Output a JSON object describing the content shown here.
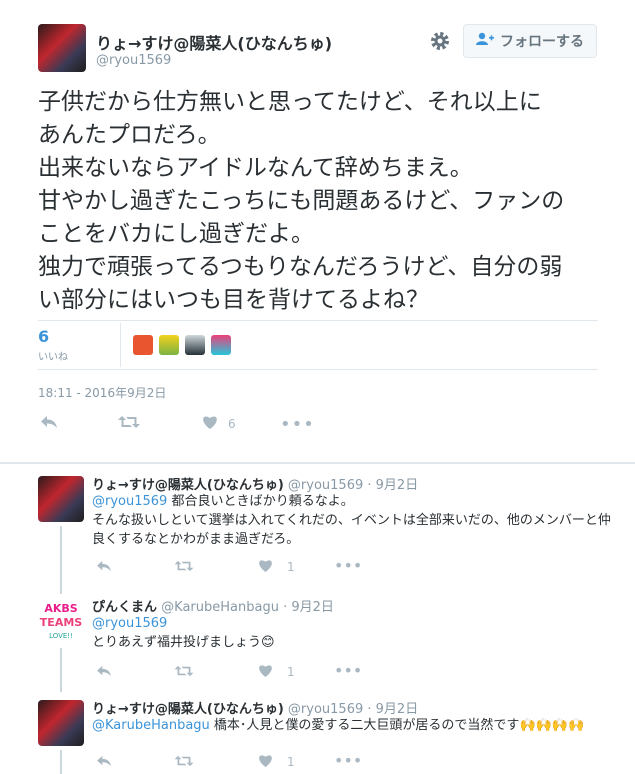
{
  "main_tweet": {
    "display_name": "りょ→すけ@陽菜人(ひなんちゅ)",
    "handle": "@ryou1569",
    "follow_label": "フォローする",
    "text": "子供だから仕方無いと思ってたけど、それ以上に\nあんたプロだろ。\n出来ないならアイドルなんて辞めちまえ。\n甘やかし過ぎたこっちにも問題あるけど、ファンの\nことをバカにし過ぎだよ。\n独力で頑張ってるつもりなんだろうけど、自分の弱\nい部分にはいつも目を背けてるよね？",
    "likes_count": "6",
    "likes_label": "いいね",
    "timestamp": "18:11 - 2016年9月2日",
    "action_like_count": "6"
  },
  "replies": [
    {
      "display_name": "りょ→すけ@陽菜人(ひなんちゅ)",
      "handle": "@ryou1569",
      "date": "· 9月2日",
      "mention": "@ryou1569",
      "text_inline": " 都合良いときばかり頼るなよ。",
      "text_rest": "そんな扱いしといて選挙は入れてくれだの、イベントは全部来いだの、他のメンバーと仲良くするなとかわがまま過ぎだろ。",
      "like_count": "1"
    },
    {
      "display_name": "ぴんくまん",
      "handle": "@KarubeHanbagu",
      "date": "· 9月2日",
      "mention": "@ryou1569",
      "text_rest": "とりあえず福井投げましょう",
      "emoji": "😊",
      "like_count": "1",
      "avatar_text": "AKBS TEAMS"
    },
    {
      "display_name": "りょ→すけ@陽菜人(ひなんちゅ)",
      "handle": "@ryou1569",
      "date": "· 9月2日",
      "mention": "@KarubeHanbagu",
      "text_inline": " 橋本･人見と僕の愛する二大巨頭が居るので当然です",
      "emoji": "🙌🙌🙌🙌",
      "like_count": "1"
    }
  ],
  "icons": {
    "settings": "gear-icon",
    "follow": "add-user-icon",
    "reply": "reply-icon",
    "retweet": "retweet-icon",
    "like": "heart-icon",
    "more": "more-icon"
  },
  "colors": {
    "link": "#3b94d9",
    "muted": "#8899a6",
    "action": "#aab8c2"
  }
}
